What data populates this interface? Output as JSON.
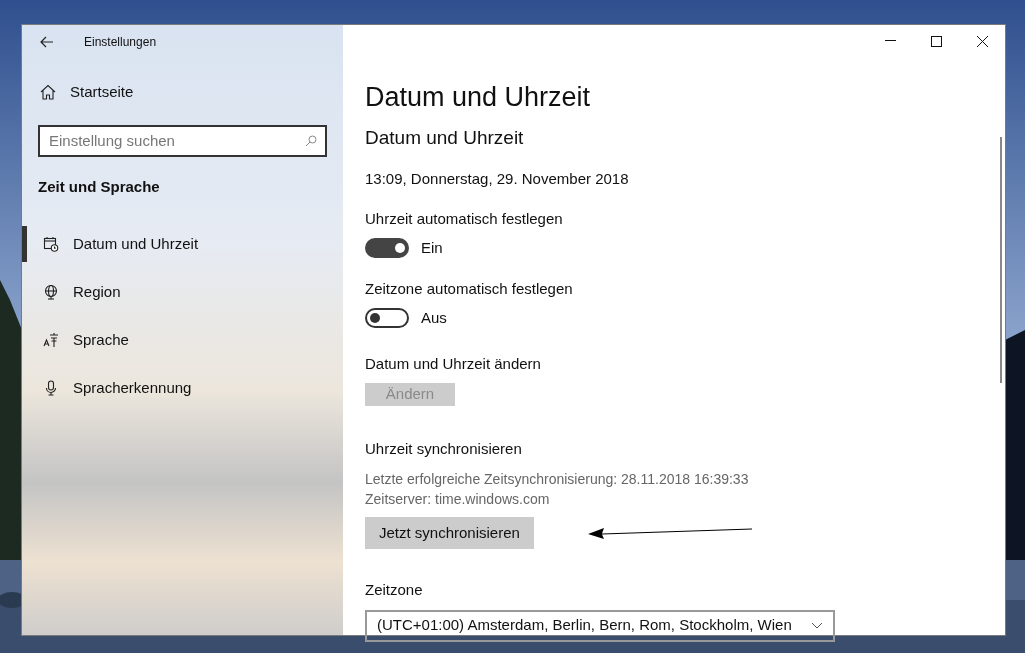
{
  "window": {
    "title": "Einstellungen"
  },
  "sidebar": {
    "home": "Startseite",
    "search": {
      "placeholder": "Einstellung suchen"
    },
    "section": "Zeit und Sprache",
    "items": [
      {
        "label": "Datum und Uhrzeit",
        "kind": "calendar",
        "selected": true
      },
      {
        "label": "Region",
        "kind": "globe",
        "selected": false
      },
      {
        "label": "Sprache",
        "kind": "language",
        "selected": false
      },
      {
        "label": "Spracherkennung",
        "kind": "microphone",
        "selected": false
      }
    ]
  },
  "page": {
    "title": "Datum und Uhrzeit",
    "subtitle": "Datum und Uhrzeit",
    "current": "13:09, Donnerstag, 29. November 2018",
    "toggles": [
      {
        "label": "Uhrzeit automatisch festlegen",
        "on": true,
        "state": "Ein"
      },
      {
        "label": "Zeitzone automatisch festlegen",
        "on": false,
        "state": "Aus"
      }
    ],
    "change": {
      "label": "Datum und Uhrzeit ändern",
      "button": "Ändern",
      "disabled": true
    },
    "sync": {
      "label": "Uhrzeit synchronisieren",
      "info": [
        "Letzte erfolgreiche Zeitsynchronisierung: 28.11.2018 16:39:33",
        "Zeitserver: time.windows.com"
      ],
      "button": "Jetzt synchronisieren",
      "disabled": false
    },
    "timezone": {
      "label": "Zeitzone",
      "value": "(UTC+01:00) Amsterdam, Berlin, Bern, Rom, Stockholm, Wien"
    }
  }
}
